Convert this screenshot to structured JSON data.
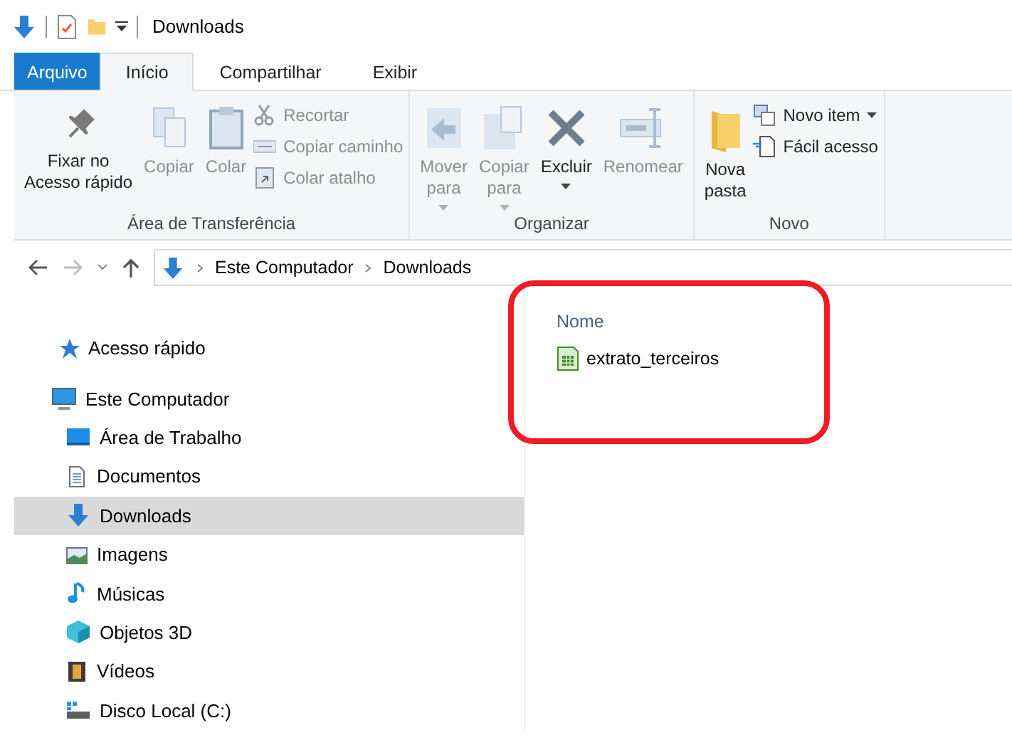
{
  "window": {
    "title": "Downloads"
  },
  "tabs": [
    {
      "label": "Arquivo",
      "kind": "file",
      "selected": false
    },
    {
      "label": "Início",
      "kind": "tab",
      "selected": true
    },
    {
      "label": "Compartilhar",
      "kind": "tab",
      "selected": false
    },
    {
      "label": "Exibir",
      "kind": "tab",
      "selected": false
    }
  ],
  "ribbon": [
    {
      "name": "Área de Transferência",
      "big": [
        {
          "label": "Fixar no\nAcesso rápido",
          "disabled": false,
          "dropdown": false
        },
        {
          "label": "Copiar",
          "disabled": true,
          "dropdown": false
        },
        {
          "label": "Colar",
          "disabled": true,
          "dropdown": false
        }
      ],
      "small": [
        {
          "label": "Recortar",
          "disabled": true,
          "dropdown": false
        },
        {
          "label": "Copiar caminho",
          "disabled": true,
          "dropdown": false
        },
        {
          "label": "Colar atalho",
          "disabled": true,
          "dropdown": false
        }
      ]
    },
    {
      "name": "Organizar",
      "big": [
        {
          "label": "Mover\npara",
          "disabled": true,
          "dropdown": true
        },
        {
          "label": "Copiar\npara",
          "disabled": true,
          "dropdown": true
        },
        {
          "label": "Excluir",
          "disabled": false,
          "dropdown": true
        },
        {
          "label": "Renomear",
          "disabled": true,
          "dropdown": false
        }
      ]
    },
    {
      "name": "Novo",
      "big": [
        {
          "label": "Nova\npasta",
          "disabled": false,
          "dropdown": false
        }
      ],
      "small": [
        {
          "label": "Novo item",
          "disabled": false,
          "dropdown": true
        },
        {
          "label": "Fácil acesso",
          "disabled": false,
          "dropdown": false
        }
      ]
    }
  ],
  "address": {
    "path": [
      "Este Computador",
      "Downloads"
    ]
  },
  "sidebar": {
    "items": [
      {
        "label": "Acesso rápido",
        "selected": false
      },
      {
        "label": "Este Computador",
        "selected": false,
        "children": [
          {
            "label": "Área de Trabalho",
            "selected": false
          },
          {
            "label": "Documentos",
            "selected": false
          },
          {
            "label": "Downloads",
            "selected": true
          },
          {
            "label": "Imagens",
            "selected": false
          },
          {
            "label": "Músicas",
            "selected": false
          },
          {
            "label": "Objetos 3D",
            "selected": false
          },
          {
            "label": "Vídeos",
            "selected": false
          },
          {
            "label": "Disco Local (C:)",
            "selected": false
          }
        ]
      }
    ]
  },
  "files": {
    "columns": [
      "Nome"
    ],
    "rows": [
      {
        "name": "extrato_terceiros"
      }
    ]
  }
}
